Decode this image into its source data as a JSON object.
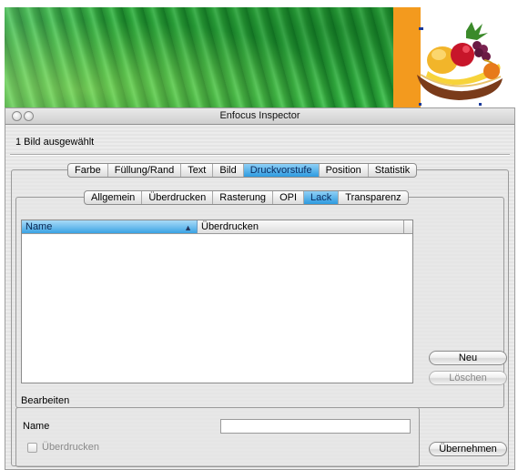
{
  "window": {
    "title": "Enfocus Inspector"
  },
  "selection": {
    "status": "1 Bild ausgewählt"
  },
  "main_tabs": [
    {
      "label": "Farbe",
      "active": false
    },
    {
      "label": "Füllung/Rand",
      "active": false
    },
    {
      "label": "Text",
      "active": false
    },
    {
      "label": "Bild",
      "active": false
    },
    {
      "label": "Druckvorstufe",
      "active": true
    },
    {
      "label": "Position",
      "active": false
    },
    {
      "label": "Statistik",
      "active": false
    }
  ],
  "sub_tabs": [
    {
      "label": "Allgemein",
      "active": false
    },
    {
      "label": "Überdrucken",
      "active": false
    },
    {
      "label": "Rasterung",
      "active": false
    },
    {
      "label": "OPI",
      "active": false
    },
    {
      "label": "Lack",
      "active": true
    },
    {
      "label": "Transparenz",
      "active": false
    }
  ],
  "table": {
    "columns": [
      "Name",
      "Überdrucken"
    ],
    "sorted_column": "Name",
    "rows": []
  },
  "buttons": {
    "new_label": "Neu",
    "delete_label": "Löschen",
    "apply_label": "Übernehmen"
  },
  "edit_section": {
    "title": "Bearbeiten",
    "name_label": "Name",
    "name_value": "",
    "overprint_label": "Überdrucken",
    "overprint_checked": false
  },
  "colors": {
    "active_tab": "#2e9be0",
    "background_green": "#2a9a36",
    "orange_accent": "#f39a1e"
  }
}
